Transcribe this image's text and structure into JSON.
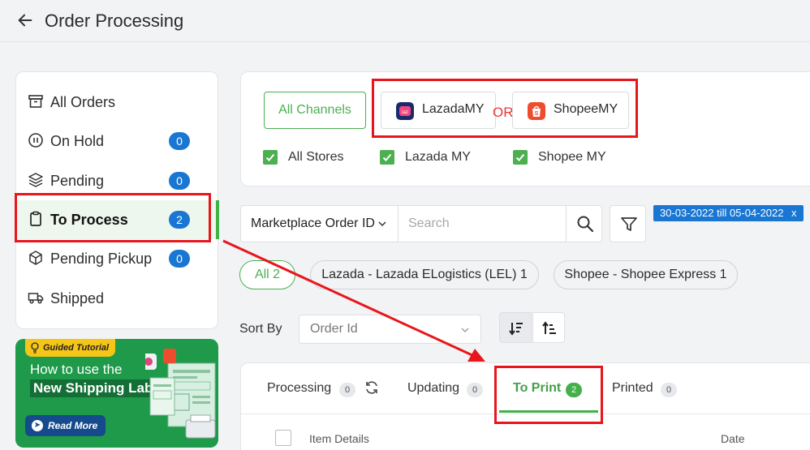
{
  "header": {
    "title": "Order Processing",
    "back_icon": "arrow-left-icon"
  },
  "sidebar": {
    "items": [
      {
        "label": "All Orders",
        "icon": "archive-box-icon",
        "badge": ""
      },
      {
        "label": "On Hold",
        "icon": "pause-circle-icon",
        "badge": "0"
      },
      {
        "label": "Pending",
        "icon": "layers-icon",
        "badge": "0"
      },
      {
        "label": "To Process",
        "icon": "clipboard-icon",
        "badge": "2",
        "active": true
      },
      {
        "label": "Pending Pickup",
        "icon": "package-icon",
        "badge": "0"
      },
      {
        "label": "Shipped",
        "icon": "truck-icon",
        "badge": ""
      }
    ]
  },
  "promo": {
    "tag": "Guided Tutorial",
    "line1": "How to use the",
    "line2": "New Shipping Label?",
    "button": "Read More"
  },
  "channels": {
    "all_label": "All Channels",
    "lazada_label": "LazadaMY",
    "shopee_label": "ShopeeMY",
    "or_text": "OR",
    "stores": [
      "All Stores",
      "Lazada MY",
      "Shopee MY"
    ]
  },
  "search": {
    "field_select": "Marketplace Order ID",
    "placeholder": "Search",
    "date_range": "30-03-2022 till 05-04-2022",
    "date_close": "x"
  },
  "pills": [
    "All 2",
    "Lazada - Lazada ELogistics (LEL) 1",
    "Shopee - Shopee Express 1"
  ],
  "sort": {
    "label": "Sort By",
    "value": "Order Id"
  },
  "tabs": [
    {
      "label": "Processing",
      "count": "0"
    },
    {
      "label": "Updating",
      "count": "0"
    },
    {
      "label": "To Print",
      "count": "2",
      "active": true
    },
    {
      "label": "Printed",
      "count": "0"
    }
  ],
  "table": {
    "columns": [
      "Item Details",
      "Date"
    ]
  },
  "colors": {
    "accent_green": "#43b04a",
    "badge_blue": "#1976d2",
    "annotation_red": "#e8161b"
  }
}
